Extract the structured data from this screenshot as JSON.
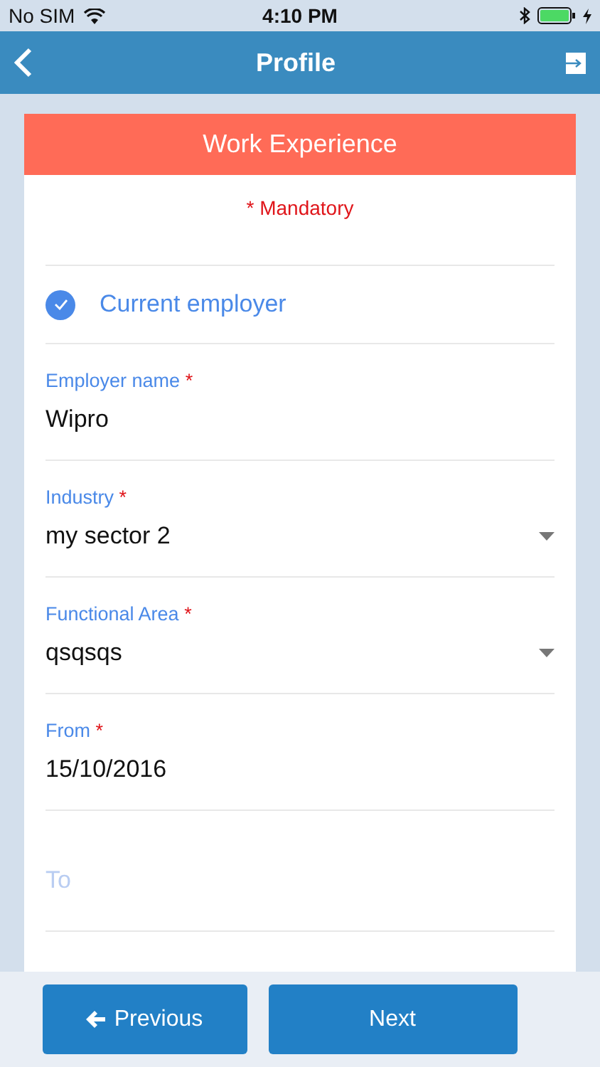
{
  "status_bar": {
    "carrier": "No SIM",
    "time": "4:10 PM"
  },
  "header": {
    "title": "Profile"
  },
  "card": {
    "title": "Work Experience",
    "mandatory_note": "* Mandatory",
    "current_employer": {
      "label": "Current employer",
      "checked": true
    },
    "fields": [
      {
        "kind": "text",
        "label": "Employer name",
        "mark": "*",
        "value": "Wipro"
      },
      {
        "kind": "select",
        "label": "Industry",
        "mark": "*",
        "value": "my sector 2"
      },
      {
        "kind": "select",
        "label": "Functional Area",
        "mark": "*",
        "value": "qsqsqs"
      },
      {
        "kind": "text",
        "label": "From",
        "mark": "*",
        "value": "15/10/2016"
      },
      {
        "kind": "empty",
        "placeholder": "To"
      }
    ]
  },
  "buttons": {
    "previous": "Previous",
    "next": "Next"
  }
}
